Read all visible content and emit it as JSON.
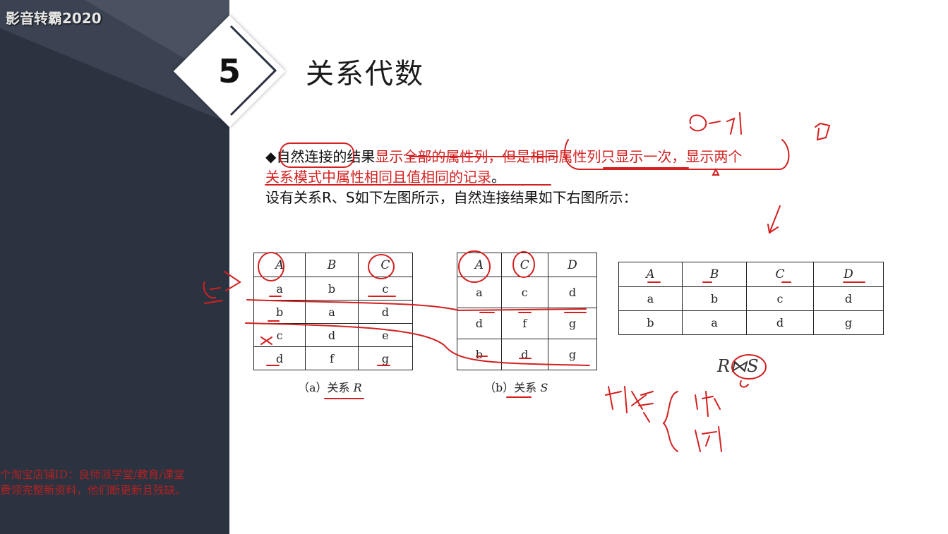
{
  "app_watermark": "影音转霸2020",
  "promo": {
    "line1": "个淘宝店铺ID：良师派学堂/教育/课堂",
    "line2": "费领完整新资料，他们断更新且残缺。"
  },
  "section": {
    "number": "5",
    "title": "关系代数"
  },
  "paragraph": {
    "bullet": "◆",
    "p1": "自然连接",
    "p2": "的结果",
    "p3": "显示全部的属性列",
    "p4": "，",
    "p5": "但是相同属性列只显示一次",
    "p6": "，显示两个",
    "p7": "关系模式中属性相同且值相同的记录",
    "p8": "。",
    "line3": "设有关系R、S如下左图所示，自然连接结果如下右图所示："
  },
  "table_r": {
    "headers": [
      "A",
      "B",
      "C"
    ],
    "rows": [
      [
        "a",
        "b",
        "c"
      ],
      [
        "b",
        "a",
        "d"
      ],
      [
        "c",
        "d",
        "e"
      ],
      [
        "d",
        "f",
        "g"
      ]
    ],
    "caption_prefix": "（a）关系 ",
    "caption_var": "R"
  },
  "table_s": {
    "headers": [
      "A",
      "C",
      "D"
    ],
    "rows": [
      [
        "a",
        "c",
        "d"
      ],
      [
        "d",
        "f",
        "g"
      ],
      [
        "b",
        "d",
        "g"
      ]
    ],
    "caption_prefix": "（b）关系 ",
    "caption_var": "S"
  },
  "table_result": {
    "headers": [
      "A",
      "B",
      "C",
      "D"
    ],
    "rows": [
      [
        "a",
        "b",
        "c",
        "d"
      ],
      [
        "b",
        "a",
        "d",
        "g"
      ]
    ]
  },
  "join_label": "R⋈S",
  "colors": {
    "panel": "#2b3240",
    "annotation_red": "#d32020"
  }
}
